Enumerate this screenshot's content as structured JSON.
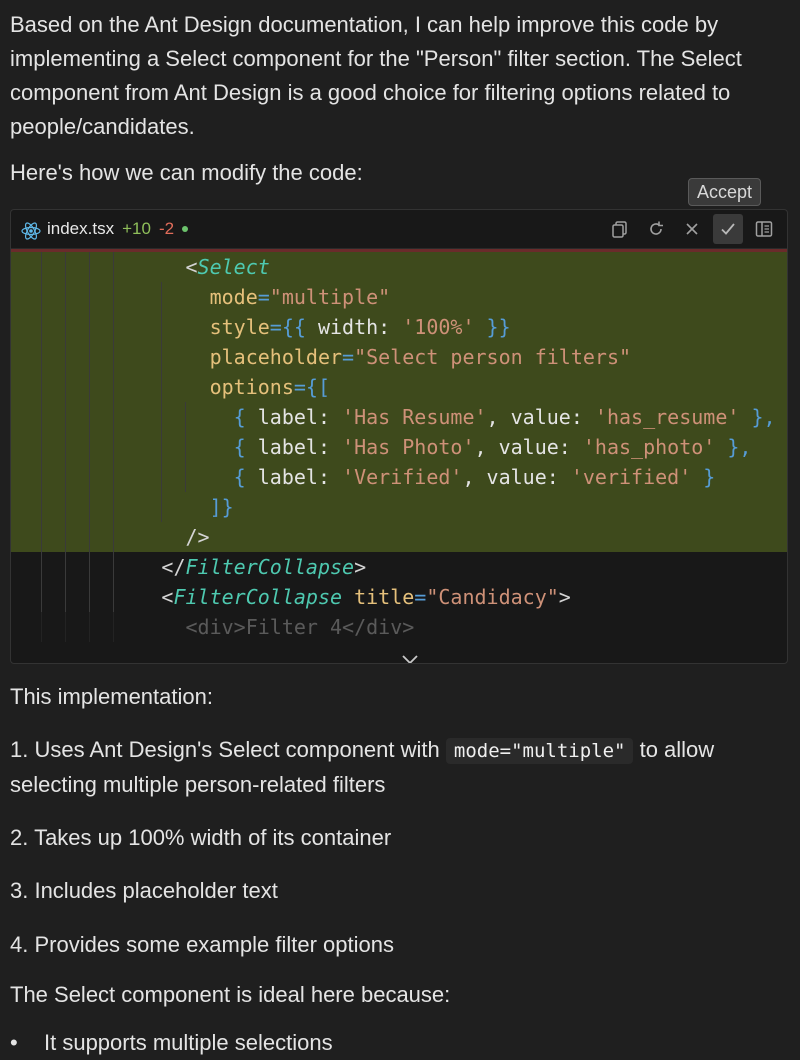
{
  "intro_paragraph": "Based on the Ant Design documentation, I can help improve this code by implementing a Select component for the \"Person\" filter section. The Select component from Ant Design is a good choice for filtering options related to people/candidates.",
  "modify_paragraph": "Here's how we can modify the code:",
  "tooltip": "Accept",
  "code_header": {
    "filename": "index.tsx",
    "added": "+10",
    "removed": "-2",
    "icons": [
      "react-icon",
      "copy-icon",
      "revert-icon",
      "close-icon",
      "check-icon",
      "panel-icon"
    ]
  },
  "code": {
    "l1_open": "<",
    "l1_comp": "Select",
    "l2_attr": "mode",
    "l2_eq": "=",
    "l2_str": "\"multiple\"",
    "l3_attr": "style",
    "l3_eq": "=",
    "l3_open": "{{",
    "l3_key": " width: ",
    "l3_str": "'100%'",
    "l3_close": " }}",
    "l4_attr": "placeholder",
    "l4_eq": "=",
    "l4_str": "\"Select person filters\"",
    "l5_attr": "options",
    "l5_eq": "=",
    "l5_open": "{[",
    "opt1": {
      "open": "{",
      "k1": " label: ",
      "v1": "'Has Resume'",
      "k2": ", value: ",
      "v2": "'has_resume'",
      "close": " },"
    },
    "opt2": {
      "open": "{",
      "k1": " label: ",
      "v1": "'Has Photo'",
      "k2": ", value: ",
      "v2": "'has_photo'",
      "close": " },"
    },
    "opt3": {
      "open": "{",
      "k1": " label: ",
      "v1": "'Verified'",
      "k2": ", value: ",
      "v2": "'verified'",
      "close": " }"
    },
    "l9": "]}",
    "l10": "/>",
    "l11_open": "</",
    "l11_comp": "FilterCollapse",
    "l11_close": ">",
    "l12_open": "<",
    "l12_comp": "FilterCollapse",
    "l12_attr": " title",
    "l12_eq": "=",
    "l12_str": "\"Candidacy\"",
    "l12_close": ">",
    "l13": "<div>Filter 4</div>"
  },
  "implementation_heading": "This implementation:",
  "points": {
    "p1_prefix": "1. Uses Ant Design's Select component with ",
    "p1_code": "mode=\"multiple\"",
    "p1_suffix": " to allow selecting multiple person-related filters",
    "p2": "2. Takes up 100% width of its container",
    "p3": "3. Includes placeholder text",
    "p4": "4. Provides some example filter options"
  },
  "ideal_because": "The Select component is ideal here because:",
  "bullets": [
    "It supports multiple selections"
  ]
}
